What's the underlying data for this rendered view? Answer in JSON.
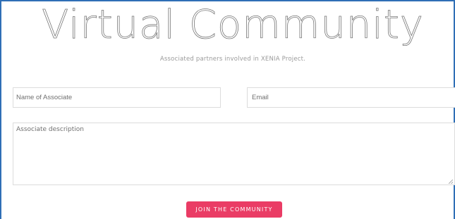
{
  "header": {
    "title": "Virtual Community",
    "subtitle": "Associated partners involved in XENIA Project."
  },
  "form": {
    "name_placeholder": "Name of Associate",
    "email_placeholder": "Email",
    "description_placeholder": "Associate description",
    "submit_label": "JOIN THE COMMUNITY"
  },
  "colors": {
    "frame_border": "#2f6fb6",
    "button_background": "#ea3c65"
  }
}
